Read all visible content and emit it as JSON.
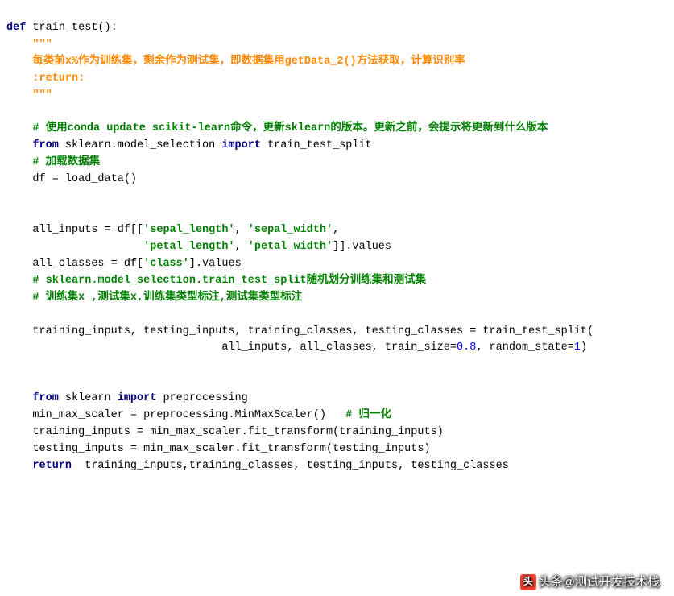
{
  "watermark": {
    "text": "头条@测试开发技术栈"
  },
  "colors": {
    "keyword": "#000080",
    "string": "#008000",
    "docstring": "#ff8800",
    "comment_green": "#008000",
    "number": "#0000ff"
  },
  "code": {
    "lines": [
      [
        [
          "kw",
          "def"
        ],
        [
          "ident",
          " train_test"
        ],
        [
          "ident",
          "():"
        ]
      ],
      [
        [
          "ident",
          "    "
        ],
        [
          "doc",
          "\"\"\""
        ]
      ],
      [
        [
          "ident",
          "    "
        ],
        [
          "doc",
          "每类前x%作为训练集，剩余作为测试集，即数据集用getData_2()方法获取，计算识别率"
        ]
      ],
      [
        [
          "ident",
          "    "
        ],
        [
          "doc",
          ":return:"
        ]
      ],
      [
        [
          "ident",
          "    "
        ],
        [
          "doc",
          "\"\"\""
        ]
      ],
      [
        [
          "ident",
          ""
        ]
      ],
      [
        [
          "ident",
          "    "
        ],
        [
          "cmt2",
          "# 使用conda update scikit-learn命令，更新sklearn的版本。更新之前，会提示将更新到什么版本"
        ]
      ],
      [
        [
          "ident",
          "    "
        ],
        [
          "kw",
          "from"
        ],
        [
          "ident",
          " sklearn.model_selection "
        ],
        [
          "kw",
          "import"
        ],
        [
          "ident",
          " train_test_split"
        ]
      ],
      [
        [
          "ident",
          "    "
        ],
        [
          "cmt2",
          "# 加载数据集"
        ]
      ],
      [
        [
          "ident",
          "    df = load_data()"
        ]
      ],
      [
        [
          "ident",
          ""
        ]
      ],
      [
        [
          "ident",
          ""
        ]
      ],
      [
        [
          "ident",
          "    all_inputs = df[["
        ],
        [
          "str",
          "'sepal_length'"
        ],
        [
          "ident",
          ", "
        ],
        [
          "str",
          "'sepal_width'"
        ],
        [
          "ident",
          ","
        ]
      ],
      [
        [
          "ident",
          "                     "
        ],
        [
          "str",
          "'petal_length'"
        ],
        [
          "ident",
          ", "
        ],
        [
          "str",
          "'petal_width'"
        ],
        [
          "ident",
          "]].values"
        ]
      ],
      [
        [
          "ident",
          "    all_classes = df["
        ],
        [
          "str",
          "'class'"
        ],
        [
          "ident",
          "].values"
        ]
      ],
      [
        [
          "ident",
          "    "
        ],
        [
          "cmt2",
          "# sklearn.model_selection.train_test_split随机划分训练集和测试集"
        ]
      ],
      [
        [
          "ident",
          "    "
        ],
        [
          "cmt2",
          "# 训练集x ,测试集x,训练集类型标注,测试集类型标注"
        ]
      ],
      [
        [
          "ident",
          ""
        ]
      ],
      [
        [
          "ident",
          "    training_inputs, testing_inputs, training_classes, testing_classes = train_test_split("
        ]
      ],
      [
        [
          "ident",
          "                                 all_inputs, all_classes, train_size="
        ],
        [
          "num",
          "0.8"
        ],
        [
          "ident",
          ", random_state="
        ],
        [
          "num",
          "1"
        ],
        [
          "ident",
          ")"
        ]
      ],
      [
        [
          "ident",
          ""
        ]
      ],
      [
        [
          "ident",
          ""
        ]
      ],
      [
        [
          "ident",
          "    "
        ],
        [
          "kw",
          "from"
        ],
        [
          "ident",
          " sklearn "
        ],
        [
          "kw",
          "import"
        ],
        [
          "ident",
          " preprocessing"
        ]
      ],
      [
        [
          "ident",
          "    min_max_scaler = preprocessing.MinMaxScaler()   "
        ],
        [
          "cmt2",
          "# 归一化"
        ]
      ],
      [
        [
          "ident",
          "    training_inputs = min_max_scaler.fit_transform(training_inputs)"
        ]
      ],
      [
        [
          "ident",
          "    testing_inputs = min_max_scaler.fit_transform(testing_inputs)"
        ]
      ],
      [
        [
          "ident",
          "    "
        ],
        [
          "kw",
          "return"
        ],
        [
          "ident",
          "  training_inputs,training_classes, testing_inputs, testing_classes"
        ]
      ]
    ]
  }
}
